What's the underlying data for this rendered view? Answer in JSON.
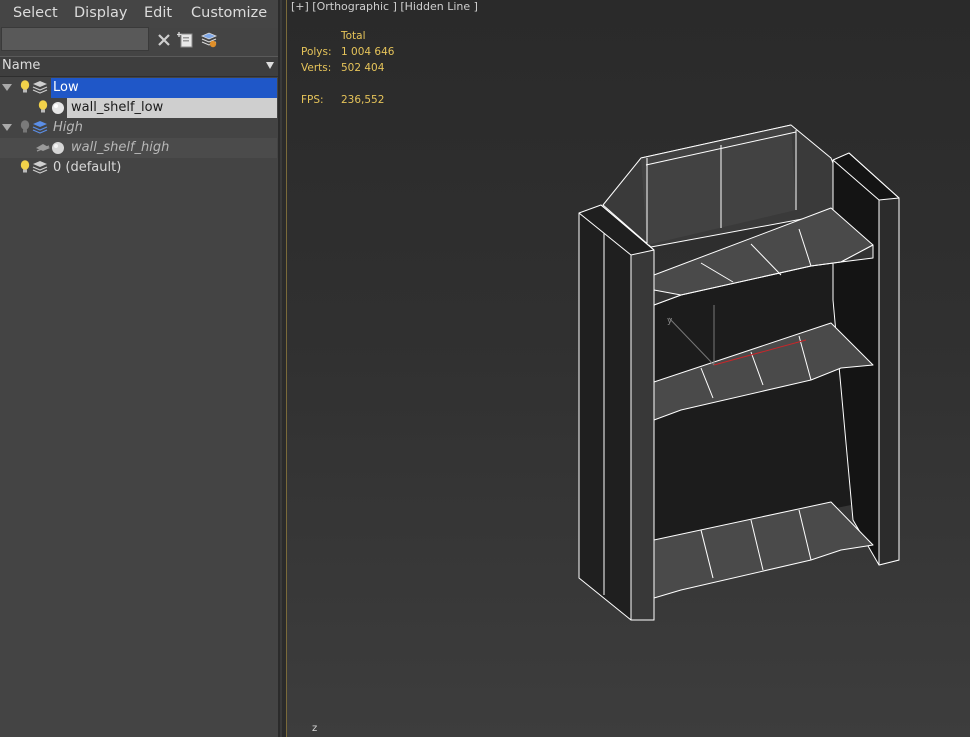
{
  "menu": {
    "select": "Select",
    "display": "Display",
    "edit": "Edit",
    "customize": "Customize"
  },
  "toolbar": {
    "search_value": "",
    "clear_icon": "close-icon",
    "add_icon": "create-layer-icon",
    "layers_icon": "layer-settings-icon"
  },
  "column_header": {
    "name": "Name"
  },
  "tree": [
    {
      "label": "Low",
      "type": "layer",
      "expanded": true,
      "selected": true
    },
    {
      "label": "wall_shelf_low",
      "type": "object",
      "selected": true
    },
    {
      "label": "High",
      "type": "layer",
      "expanded": true,
      "hidden": true
    },
    {
      "label": "wall_shelf_high",
      "type": "object",
      "hidden": true
    },
    {
      "label": "0 (default)",
      "type": "layer"
    }
  ],
  "viewport": {
    "label": "[+] [Orthographic ] [Hidden Line ]",
    "stats": {
      "total_header": "Total",
      "polys_label": "Polys:",
      "polys_value": "1 004 646",
      "verts_label": "Verts:",
      "verts_value": "502 404",
      "fps_label": "FPS:",
      "fps_value": "236,552"
    },
    "axis_label": "z"
  },
  "colors": {
    "selection_blue": "#1f57c8",
    "stats_yellow": "#e6c45a",
    "wireframe": "#ffffff"
  }
}
